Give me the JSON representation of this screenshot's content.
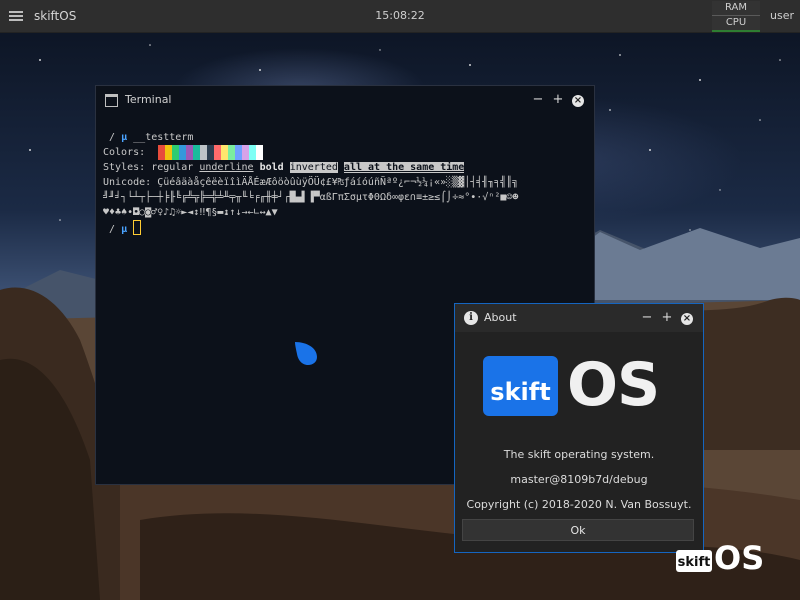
{
  "panel": {
    "os_name": "skiftOS",
    "time": "15:08:22",
    "ram_label": "RAM",
    "cpu_label": "CPU",
    "user": "user"
  },
  "terminal": {
    "title": "Terminal",
    "prompt_symbol": "/",
    "prompt_char": "µ",
    "command": "__testterm",
    "colors_label": "Colors:",
    "palette": [
      "#0c111a",
      "#e74c3c",
      "#f1c40f",
      "#2ecc71",
      "#3498db",
      "#9b59b6",
      "#1abc9c",
      "#bdc3c7",
      "#2c3e50",
      "#ff6b6b",
      "#ffe66d",
      "#7bed9f",
      "#70a1ff",
      "#d6a2e8",
      "#7efff5",
      "#ffffff"
    ],
    "styles_label": "Styles:",
    "style_regular": "regular",
    "style_underline": "underline",
    "style_bold": "bold",
    "style_inverted": "inverted",
    "style_all": "all at the same time",
    "unicode_label": "Unicode:",
    "unicode_line1": "ÇüéâäàåçêëèïîìÄÅÉæÆôöòûùÿÖÜ¢£¥₧ƒáíóúñÑªº¿⌐¬½¼¡«»░▒▓│┤╡╢╖╕╣║╗",
    "unicode_line2": "╝╜╛┐└┴┬├─┼╞╟╚╔╩╦╠═╬╧╨╤╥╙╘╒╓╫╪┘┌█▄▌▐▀αßΓπΣσµτΦΘΩδ∞φε∩≡±≥≤⌠⌡÷≈°∙·√ⁿ²■☺☻",
    "unicode_line3": "♥♦♣♠•◘○◙♂♀♪♫☼►◄↕‼¶§▬↨↑↓→←∟↔▲▼"
  },
  "about": {
    "title": "About",
    "logo_word": "skift",
    "logo_os": "OS",
    "description": "The skift operating system.",
    "version": "master@8109b7d/debug",
    "copyright": "Copyright (c) 2018-2020 N. Van Bossuyt.",
    "ok_label": "Ok"
  },
  "corner_logo": {
    "word": "skift",
    "os": "OS"
  },
  "colors": {
    "accent": "#1a73e8",
    "prompt": "#4aa3ff",
    "cursor": "#ffcc33"
  }
}
